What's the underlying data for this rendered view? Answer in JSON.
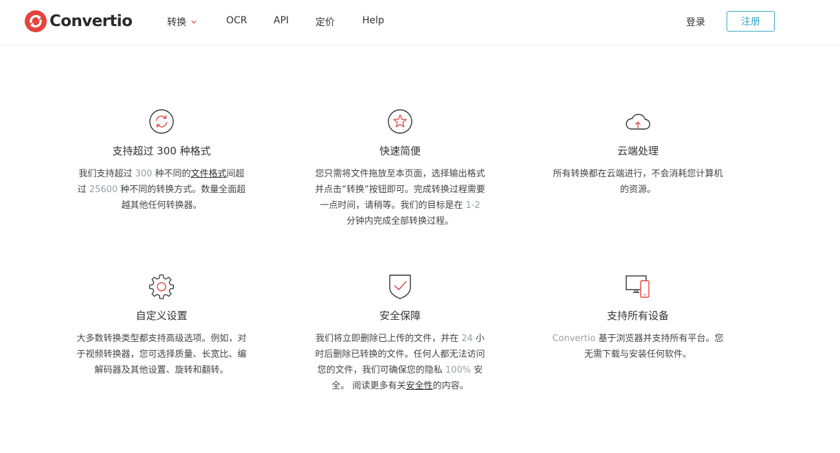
{
  "header": {
    "brand": "Convertio",
    "nav": [
      {
        "label": "转换",
        "has_dropdown": true
      },
      {
        "label": "OCR"
      },
      {
        "label": "API"
      },
      {
        "label": "定价"
      },
      {
        "label": "Help"
      }
    ],
    "login_label": "登录",
    "register_label": "注册",
    "colors": {
      "brand_red": "#e5433e",
      "register_border": "#3aa9c8"
    }
  },
  "features": [
    {
      "icon": "refresh-icon",
      "title": "支持超过 300 种格式",
      "body": {
        "a": "我们支持超过 ",
        "b": "300",
        "c": " 种不同的",
        "d": "文件格式",
        "e": "间超过 ",
        "f": "25600",
        "g": " 种不同的转换方式。数量全面超越其他任何转换器。"
      }
    },
    {
      "icon": "star-icon",
      "title": "快速简便",
      "body": {
        "a": "您只需将文件拖放至本页面，选择输出格式并点击“转换”按钮即可。完成转换过程需要一点时间，请稍等。我们的目标是在 ",
        "b": "1-2",
        "c": " 分钟内完成全部转换过程。"
      }
    },
    {
      "icon": "cloud-upload-icon",
      "title": "云端处理",
      "body": {
        "a": "所有转换都在云端进行，不会消耗您计算机的资源。"
      }
    },
    {
      "icon": "gear-icon",
      "title": "自定义设置",
      "body": {
        "a": "大多数转换类型都支持高级选项。例如，对于视频转换器，您可选择质量、长宽比、编解码器及其他设置、旋转和翻转。"
      }
    },
    {
      "icon": "shield-check-icon",
      "title": "安全保障",
      "body": {
        "a": "我们将立即删除已上传的文件，并在 ",
        "b": "24",
        "c": " 小时后删除已转换的文件。任何人都无法访问您的文件，我们可确保您的隐私 ",
        "d": "100%",
        "e": " 安全。 阅读更多有关",
        "f": "安全性",
        "g": "的内容。"
      }
    },
    {
      "icon": "devices-icon",
      "title": "支持所有设备",
      "body": {
        "a": "Convertio",
        "b": " 基于浏览器并支持所有平台。您无需下载与安装任何软件。"
      }
    }
  ]
}
